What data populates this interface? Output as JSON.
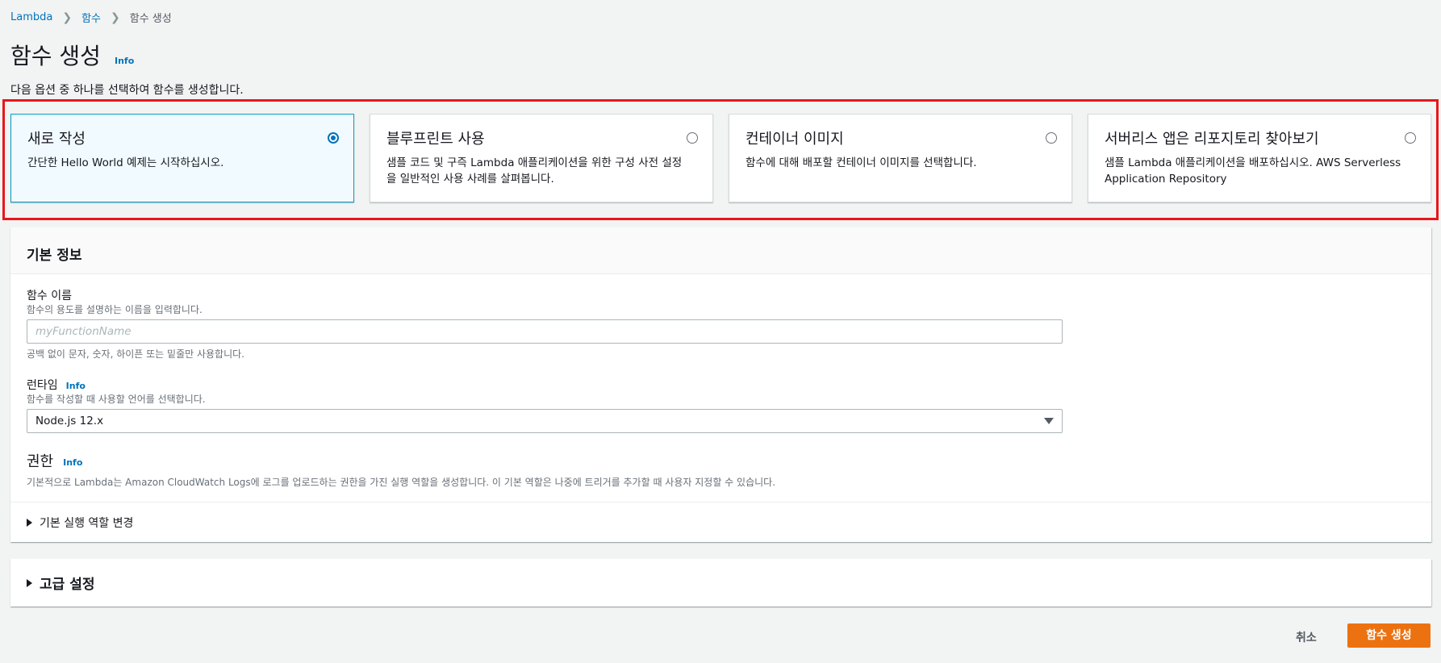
{
  "breadcrumb": {
    "items": [
      "Lambda",
      "함수",
      "함수 생성"
    ]
  },
  "page": {
    "title": "함수 생성",
    "info": "Info",
    "subtitle": "다음 옵션 중 하나를 선택하여 함수를 생성합니다."
  },
  "options": [
    {
      "title": "새로 작성",
      "desc": "간단한 Hello World 예제는 시작하십시오.",
      "selected": true
    },
    {
      "title": "블루프린트 사용",
      "desc": "샘플 코드 및 구즉 Lambda 애플리케이션을 위한 구성 사전 설정을 일반적인 사용 사례를 살펴봅니다.",
      "selected": false
    },
    {
      "title": "컨테이너 이미지",
      "desc": "함수에 대해 배포할 컨테이너 이미지를 선택합니다.",
      "selected": false
    },
    {
      "title": "서버리스 앱은 리포지토리 찾아보기",
      "desc": "샘플 Lambda 애플리케이션을 배포하십시오. AWS Serverless Application Repository",
      "selected": false
    }
  ],
  "basic": {
    "header": "기본 정보",
    "name_label": "함수 이름",
    "name_desc": "함수의 용도를 설명하는 이름을 입력합니다.",
    "name_placeholder": "myFunctionName",
    "name_hint": "공백 없이 문자, 숫자, 하이픈 또는 밑줄만 사용합니다.",
    "runtime_label": "런타임",
    "runtime_info": "Info",
    "runtime_desc": "함수를 작성할 때 사용할 언어를 선택합니다.",
    "runtime_value": "Node.js 12.x",
    "perm_label": "권한",
    "perm_info": "Info",
    "perm_desc": "기본적으로 Lambda는 Amazon CloudWatch Logs에 로그를 업로드하는 권한을 가진 실행 역할을 생성합니다. 이 기본 역할은 나중에 트리거를 추가할 때 사용자 지정할 수 있습니다.",
    "role_expander": "기본 실행 역할 변경"
  },
  "advanced": {
    "header": "고급 설정"
  },
  "footer": {
    "cancel": "취소",
    "create": "함수 생성"
  },
  "colors": {
    "accent": "#0073bb",
    "primary_button": "#ec7211",
    "highlight": "#e8161b"
  }
}
